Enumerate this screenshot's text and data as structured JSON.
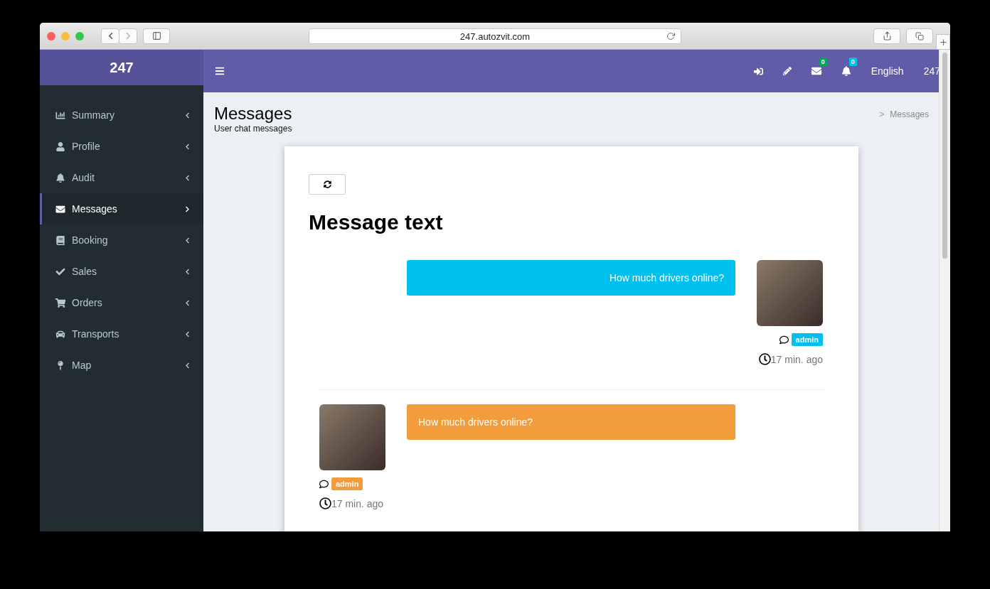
{
  "browser": {
    "url": "247.autozvit.com"
  },
  "sidebar": {
    "brand": "247",
    "items": [
      {
        "label": "Summary",
        "selected": false
      },
      {
        "label": "Profile",
        "selected": false
      },
      {
        "label": "Audit",
        "selected": false
      },
      {
        "label": "Messages",
        "selected": true
      },
      {
        "label": "Booking",
        "selected": false
      },
      {
        "label": "Sales",
        "selected": false
      },
      {
        "label": "Orders",
        "selected": false
      },
      {
        "label": "Transports",
        "selected": false
      },
      {
        "label": "Map",
        "selected": false
      }
    ]
  },
  "topbar": {
    "badges": [
      {
        "count": "0",
        "color": "#00a65a"
      },
      {
        "count": "0",
        "color": "#00c0ef"
      }
    ],
    "language": "English",
    "user": "247"
  },
  "page": {
    "title": "Messages",
    "subtitle": "User chat messages",
    "breadcrumb": [
      {
        "sep": ">",
        "label": "Messages"
      }
    ]
  },
  "chat": {
    "heading": "Message text",
    "messages": [
      {
        "kind": "outgoing",
        "text": "How much drivers online?",
        "author": "admin",
        "time": "17 min. ago",
        "color": "#00c0ef"
      },
      {
        "kind": "incoming",
        "text": "How much drivers online?",
        "author": "admin",
        "time": "17 min. ago",
        "color": "#f39c3c"
      }
    ]
  }
}
